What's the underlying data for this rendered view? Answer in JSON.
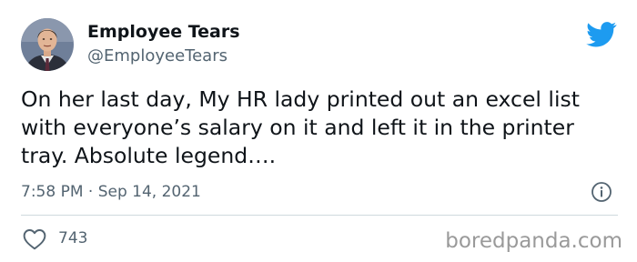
{
  "author": {
    "display_name": "Employee Tears",
    "handle": "@EmployeeTears",
    "avatar_icon": "profile-photo"
  },
  "tweet": {
    "text": "On her last day, My HR lady printed out an excel list with everyone’s salary on it and left it in the printer tray. Absolute legend….",
    "timestamp": "7:58 PM · Sep 14, 2021"
  },
  "engagement": {
    "likes": "743"
  },
  "icons": {
    "logo": "twitter-bird-icon",
    "info": "info-icon",
    "like": "heart-icon"
  },
  "watermark": "boredpanda.com",
  "colors": {
    "twitter_blue": "#1d9bf0",
    "text_primary": "#0f1419",
    "text_secondary": "#536471",
    "divider": "#cfd9de"
  }
}
